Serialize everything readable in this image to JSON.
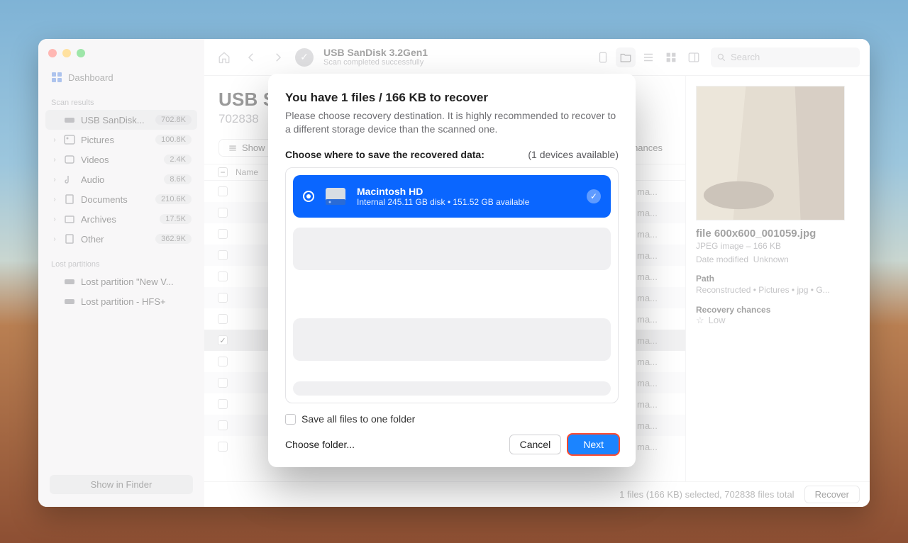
{
  "toolbar": {
    "title": "USB  SanDisk 3.2Gen1",
    "subtitle": "Scan completed successfully",
    "search_placeholder": "Search"
  },
  "sidebar": {
    "dashboard": "Dashboard",
    "scan_results_header": "Scan results",
    "items": [
      {
        "label": "USB  SanDisk...",
        "badge": "702.8K"
      },
      {
        "label": "Pictures",
        "badge": "100.8K"
      },
      {
        "label": "Videos",
        "badge": "2.4K"
      },
      {
        "label": "Audio",
        "badge": "8.6K"
      },
      {
        "label": "Documents",
        "badge": "210.6K"
      },
      {
        "label": "Archives",
        "badge": "17.5K"
      },
      {
        "label": "Other",
        "badge": "362.9K"
      }
    ],
    "lost_header": "Lost partitions",
    "lost": [
      {
        "label": "Lost partition \"New V..."
      },
      {
        "label": "Lost partition - HFS+"
      }
    ],
    "show_in_finder": "Show in Finder"
  },
  "header": {
    "title_fragment": "USB  S",
    "sub_fragment": "702838"
  },
  "filters": {
    "show": "Show",
    "chances": "chances"
  },
  "columns": {
    "name": "Name"
  },
  "rows_fragment": "ma...",
  "info": {
    "filename": "file 600x600_001059.jpg",
    "type_line": "JPEG image – 166 KB",
    "date_label": "Date modified",
    "date_value": "Unknown",
    "path_label": "Path",
    "path_value": "Reconstructed • Pictures • jpg • G...",
    "chances_label": "Recovery chances",
    "chances_value": "Low"
  },
  "statusbar": {
    "summary": "1 files (166 KB) selected, 702838 files total",
    "recover": "Recover"
  },
  "modal": {
    "title": "You have 1 files / 166 KB to recover",
    "desc": "Please choose recovery destination. It is highly recommended to recover to a different storage device than the scanned one.",
    "choose_label": "Choose where to save the recovered data:",
    "devices_available": "(1 devices available)",
    "device": {
      "name": "Macintosh HD",
      "detail": "Internal 245.11 GB disk • 151.52 GB available"
    },
    "save_all": "Save all files to one folder",
    "choose_folder": "Choose folder...",
    "cancel": "Cancel",
    "next": "Next"
  }
}
